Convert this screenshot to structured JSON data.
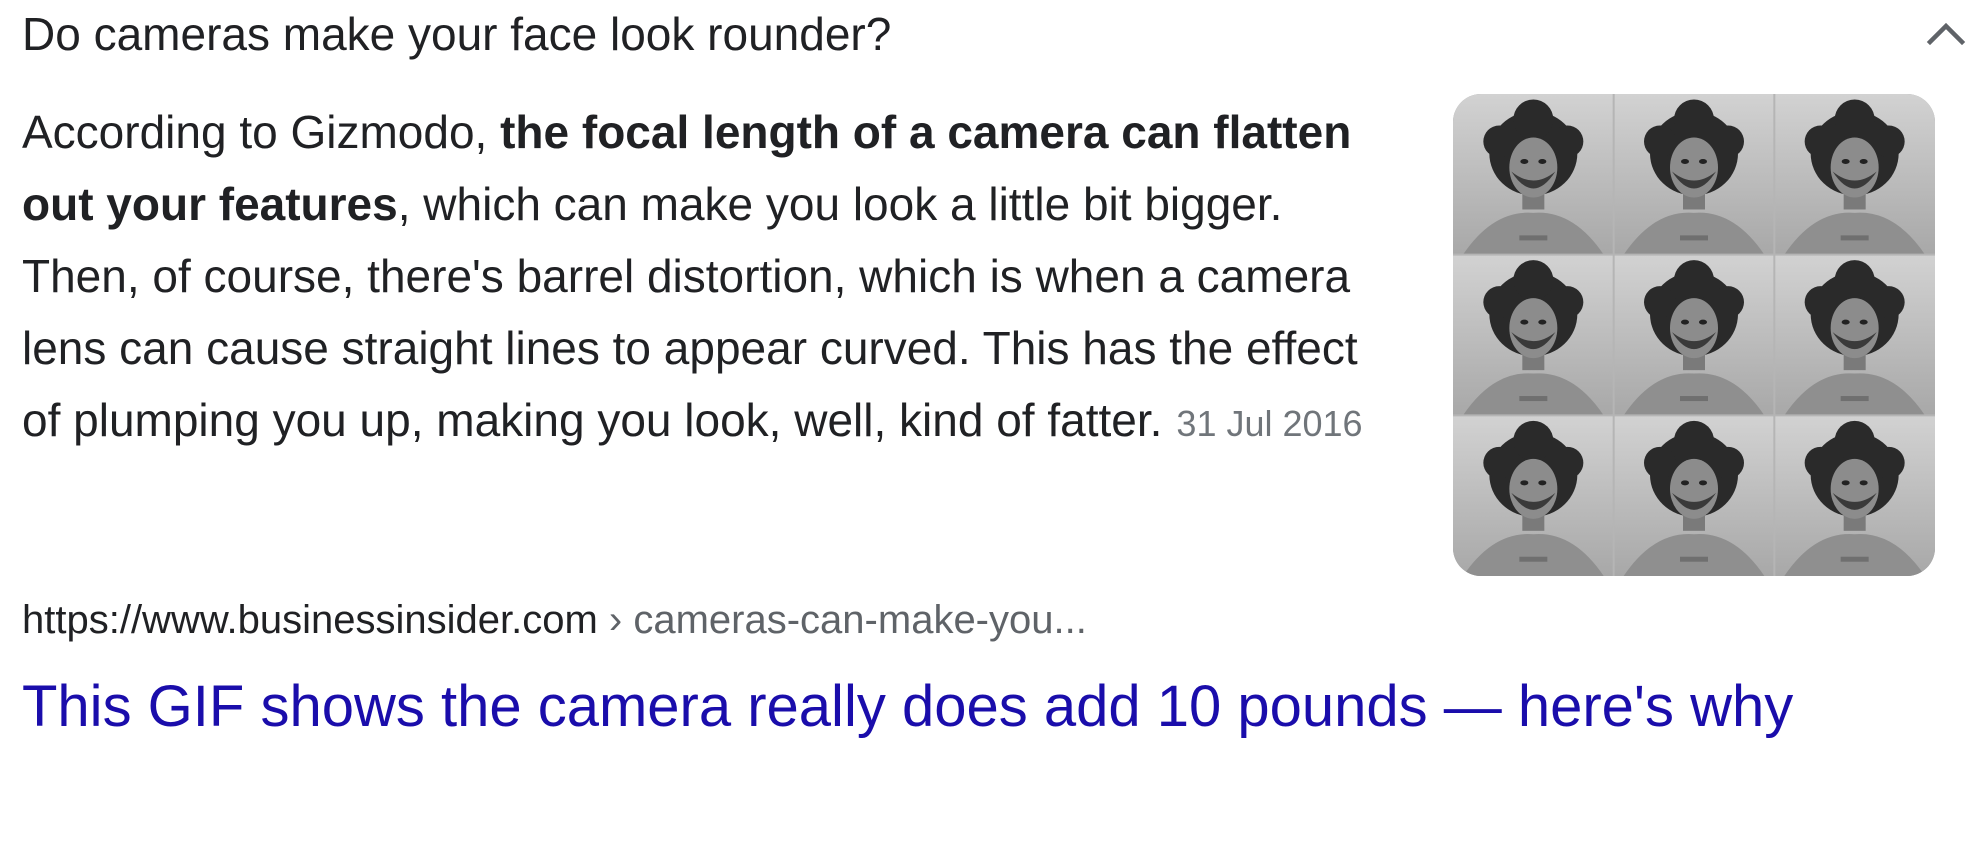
{
  "faq": {
    "question": "Do cameras make your face look rounder?",
    "collapse_icon": "chevron-up-icon",
    "answer": {
      "lead": "According to Gizmodo, ",
      "bold": "the focal length of a camera can flatten out your features",
      "rest": ", which can make you look a little bit bigger. Then, of course, there's barrel distortion, which is when a camera lens can cause straight lines to appear curved. This has the effect of plumping you up, making you look, well, kind of fatter.",
      "date": "31 Jul 2016"
    },
    "thumbnail": {
      "description": "3x3 grid of grayscale portraits",
      "rows": 3,
      "cols": 3
    }
  },
  "result": {
    "site": "https://www.businessinsider.com",
    "path": " › cameras-can-make-you...",
    "title": "This GIF shows the camera really does add 10 pounds — here's why"
  },
  "colors": {
    "link": "#1a0dab",
    "text": "#202124",
    "muted": "#70757a"
  }
}
